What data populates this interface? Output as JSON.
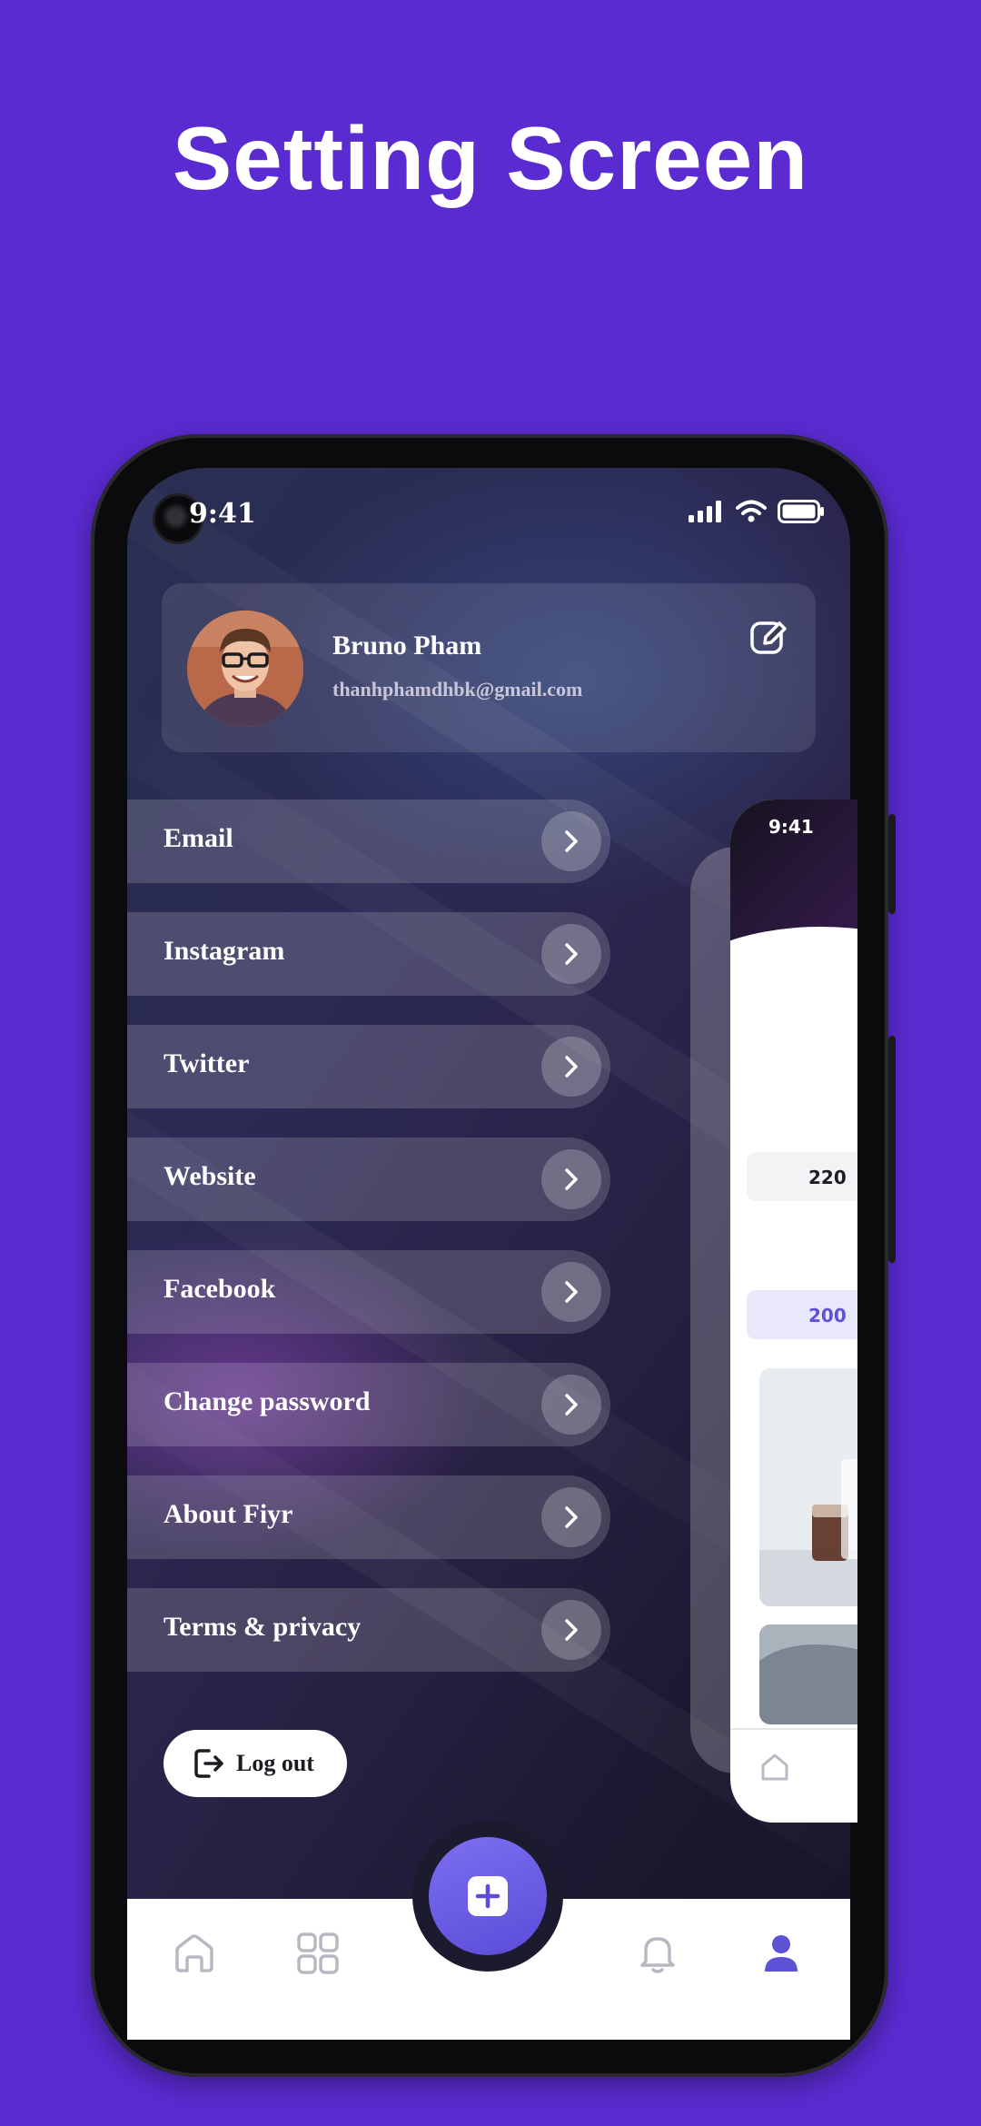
{
  "headline": "Setting Screen",
  "status_bar": {
    "time": "9:41"
  },
  "profile": {
    "name": "Bruno Pham",
    "email": "thanhphamdhbk@gmail.com"
  },
  "menu": [
    {
      "label": "Email"
    },
    {
      "label": "Instagram"
    },
    {
      "label": "Twitter"
    },
    {
      "label": "Website"
    },
    {
      "label": "Facebook"
    },
    {
      "label": "Change password"
    },
    {
      "label": "About Fiyr"
    },
    {
      "label": "Terms & privacy"
    }
  ],
  "logout": {
    "label": "Log out"
  },
  "preview": {
    "time": "9:41",
    "stat_1": "220",
    "stat_2": "200"
  },
  "bottom_nav": {
    "items": [
      {
        "icon": "home-icon"
      },
      {
        "icon": "grid-icon"
      },
      {
        "icon": "plus-icon"
      },
      {
        "icon": "bell-icon"
      },
      {
        "icon": "profile-icon"
      }
    ],
    "active": "profile-icon"
  },
  "colors": {
    "background": "#5b2bd2",
    "accent": "#5a4cd8",
    "active_nav": "#5d52d6"
  }
}
